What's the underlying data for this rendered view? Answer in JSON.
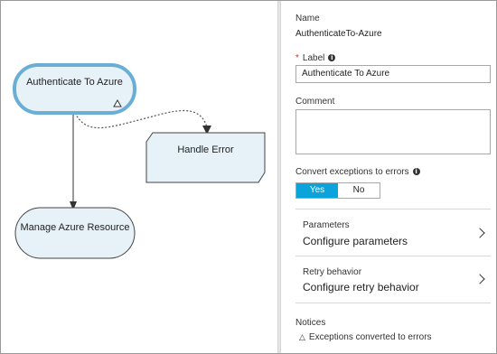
{
  "canvas": {
    "nodes": {
      "authenticate": "Authenticate To Azure",
      "handle_error": "Handle Error",
      "manage": "Manage Azure Resource"
    }
  },
  "panel": {
    "name_label": "Name",
    "name_value": "AuthenticateTo-Azure",
    "label_required_mark": "*",
    "label_label": "Label",
    "label_value": "Authenticate To Azure",
    "comment_label": "Comment",
    "comment_value": "",
    "convert_label": "Convert exceptions to errors",
    "convert_options": {
      "yes": "Yes",
      "no": "No",
      "selected": "Yes"
    },
    "parameters": {
      "title": "Parameters",
      "value": "Configure parameters"
    },
    "retry": {
      "title": "Retry behavior",
      "value": "Configure retry behavior"
    },
    "notices": {
      "title": "Notices",
      "item": "Exceptions converted to errors",
      "icon": "warning-triangle-icon"
    }
  },
  "colors": {
    "accent": "#0aa3dc",
    "node_fill": "#e6f1f8",
    "selected_border": "#6aaed6"
  }
}
